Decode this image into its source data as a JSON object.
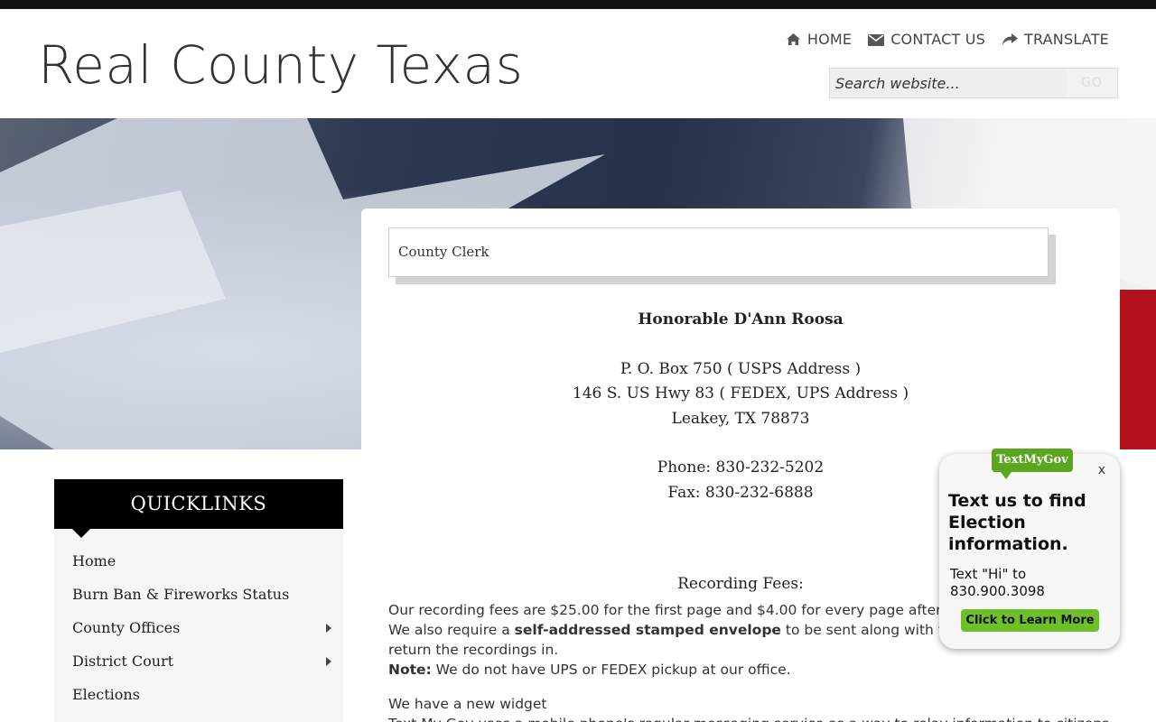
{
  "site": {
    "title": "Real County Texas"
  },
  "topnav": {
    "home": "HOME",
    "contact": "CONTACT US",
    "translate": "TRANSLATE"
  },
  "search": {
    "placeholder": "Search website...",
    "go": "GO"
  },
  "page": {
    "heading": "County Clerk"
  },
  "clerk": {
    "name": "Honorable D'Ann Roosa",
    "address1": "P. O. Box 750 ( USPS Address )",
    "address2": "146 S. US Hwy 83 ( FEDEX, UPS Address )",
    "address3": "Leakey, TX 78873",
    "phone": "Phone: 830-232-5202",
    "fax": "Fax: 830-232-6888"
  },
  "fees": {
    "title": "Recording Fees:",
    "line1": "Our recording fees are $25.00 for the first page and $4.00 for every page after.",
    "line2_pre": "We also require a ",
    "line2_bold": "self-addressed stamped envelope",
    "line2_post": " to be sent along with the recordings for us to",
    "line3": "return the recordings in.",
    "note_label": "Note:",
    "note_text": " We do not have UPS or FEDEX pickup at our office."
  },
  "widget": {
    "line1": "We have a new widget",
    "line2": "Text My Gov uses a mobile phone's regular messaging service as a way to relay information to citizens"
  },
  "quicklinks": {
    "title": "QUICKLINKS",
    "items": [
      {
        "label": "Home",
        "submenu": false
      },
      {
        "label": "Burn Ban & Fireworks Status",
        "submenu": false
      },
      {
        "label": "County Offices",
        "submenu": true
      },
      {
        "label": "District Court",
        "submenu": true
      },
      {
        "label": "Elections",
        "submenu": false
      }
    ]
  },
  "textmygov": {
    "logo": "TextMyGov",
    "close": "x",
    "title": "Text us to find Election information.",
    "body": "Text \"Hi\" to 830.900.3098",
    "button": "Click to Learn More"
  },
  "colors": {
    "accent_green": "#6dc02a",
    "banner_red": "#b3121a"
  }
}
